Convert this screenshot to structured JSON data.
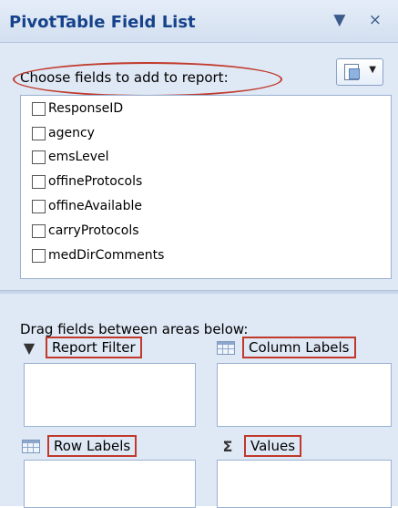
{
  "panel": {
    "title": "PivotTable Field List",
    "title_buttons": "▼ ×"
  },
  "choose_label": "Choose fields to add to report:",
  "fields": [
    {
      "label": "ResponseID",
      "checked": false
    },
    {
      "label": "agency",
      "checked": false
    },
    {
      "label": "emsLevel",
      "checked": false
    },
    {
      "label": "offineProtocols",
      "checked": false
    },
    {
      "label": "offineAvailable",
      "checked": false
    },
    {
      "label": "carryProtocols",
      "checked": false
    },
    {
      "label": "medDirComments",
      "checked": false
    }
  ],
  "drag_label": "Drag fields between areas below:",
  "areas": {
    "report_filter": {
      "label": "Report Filter",
      "icon": "filter-icon"
    },
    "column_labels": {
      "label": "Column Labels",
      "icon": "columns-grid-icon"
    },
    "row_labels": {
      "label": "Row Labels",
      "icon": "rows-grid-icon"
    },
    "values": {
      "label": "Values",
      "icon": "sigma-icon"
    }
  },
  "colors": {
    "title": "#15428b",
    "highlight": "#c0392b",
    "panel_bg": "#dfe8f5"
  }
}
